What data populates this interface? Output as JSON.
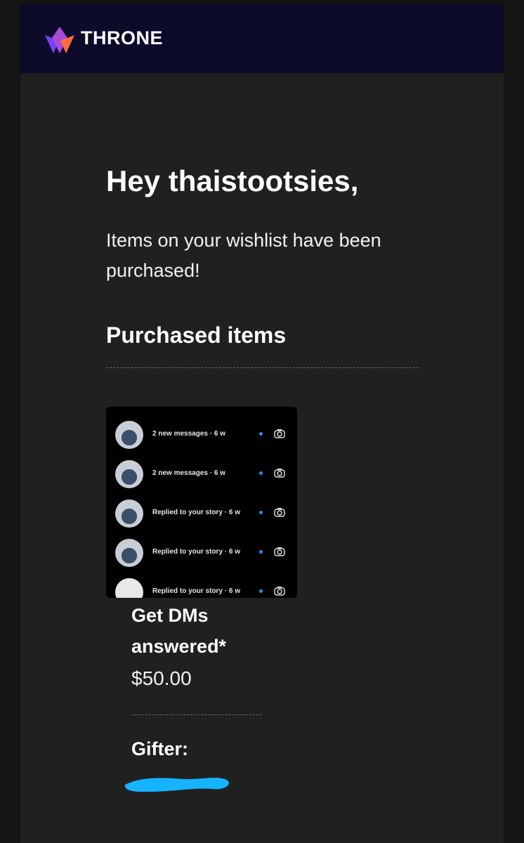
{
  "brand": {
    "name": "THRONE",
    "logo_icon": "crown-logo-icon",
    "colors": {
      "header_bg": "#0c0b2a",
      "logo_purple": "#7b3ff2",
      "logo_orange": "#ff6a3d"
    }
  },
  "email": {
    "greeting": "Hey thaistootsies,",
    "intro": "Items on your wishlist have been purchased!",
    "section_title": "Purchased items"
  },
  "item": {
    "name": "Get DMs answered*",
    "price": "$50.00",
    "image": {
      "rows": [
        {
          "text": "2 new messages · 6 w"
        },
        {
          "text": "2 new messages · 6 w"
        },
        {
          "text": "Replied to your story · 6 w"
        },
        {
          "text": "Replied to your story · 6 w"
        },
        {
          "text": "Replied to your story · 6 w"
        }
      ]
    }
  },
  "gifter": {
    "label": "Gifter:",
    "redaction_color": "#16b4ff"
  }
}
